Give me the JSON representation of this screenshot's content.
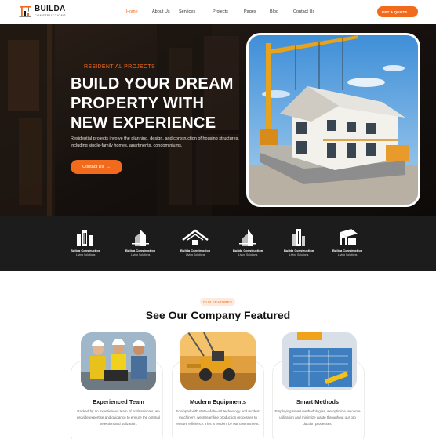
{
  "header": {
    "logo_name": "BUILDA",
    "logo_sub": "CONSTRUCTIONS",
    "nav": [
      {
        "label": "Home",
        "has_dropdown": true,
        "active": true
      },
      {
        "label": "About Us",
        "has_dropdown": false,
        "active": false
      },
      {
        "label": "Services",
        "has_dropdown": true,
        "active": false
      },
      {
        "label": "Projects",
        "has_dropdown": true,
        "active": false
      },
      {
        "label": "Pages",
        "has_dropdown": true,
        "active": false
      },
      {
        "label": "Blog",
        "has_dropdown": true,
        "active": false
      },
      {
        "label": "Contact Us",
        "has_dropdown": false,
        "active": false
      }
    ],
    "quote_button": "GET A QUOTE"
  },
  "hero": {
    "tagline": "RESIDENTIAL PROJECTS",
    "title_line1": "BUILD YOUR DREAM",
    "title_line2": "PROPERTY WITH",
    "title_line3": "NEW EXPERIENCE",
    "description": "Residential projects involve the planning, design, and construction of housing structures, including single-family homes, apartments, condominiums.",
    "cta_button": "Contact Us"
  },
  "brands": [
    {
      "name": "Builda Construction",
      "sub": "Living Solutions",
      "icon": "buildings-icon"
    },
    {
      "name": "Builda Construction",
      "sub": "Living Solutions",
      "icon": "tower-icon"
    },
    {
      "name": "Builda Construction",
      "sub": "Living Solutions",
      "icon": "house-roof-icon"
    },
    {
      "name": "Builda Construction",
      "sub": "Living Solutions",
      "icon": "tower-icon"
    },
    {
      "name": "Builda Construction",
      "sub": "Living Solutions",
      "icon": "skyscraper-icon"
    },
    {
      "name": "Builda Construction",
      "sub": "Living Solutions",
      "icon": "house-roof-icon"
    }
  ],
  "features": {
    "badge": "OUR FEATURES",
    "title": "See Our Company Featured",
    "cards": [
      {
        "title": "Experienced Team",
        "text": "Backed by an experienced team of professionals, we provide expertise and guidance to ensure the optimal selection and utilization."
      },
      {
        "title": "Modern Equipments",
        "text": "Equipped with state-of-the-art technology and modern machinery, we streamline production processes to ensure efficiency. This is evident by our commitment."
      },
      {
        "title": "Smart Methods",
        "text": "Employing smart methodologies, we optimize resource utilization and minimize waste throughout our pro duction processes."
      }
    ]
  },
  "colors": {
    "accent": "#f26b1d",
    "dark": "#1c1c1c"
  }
}
